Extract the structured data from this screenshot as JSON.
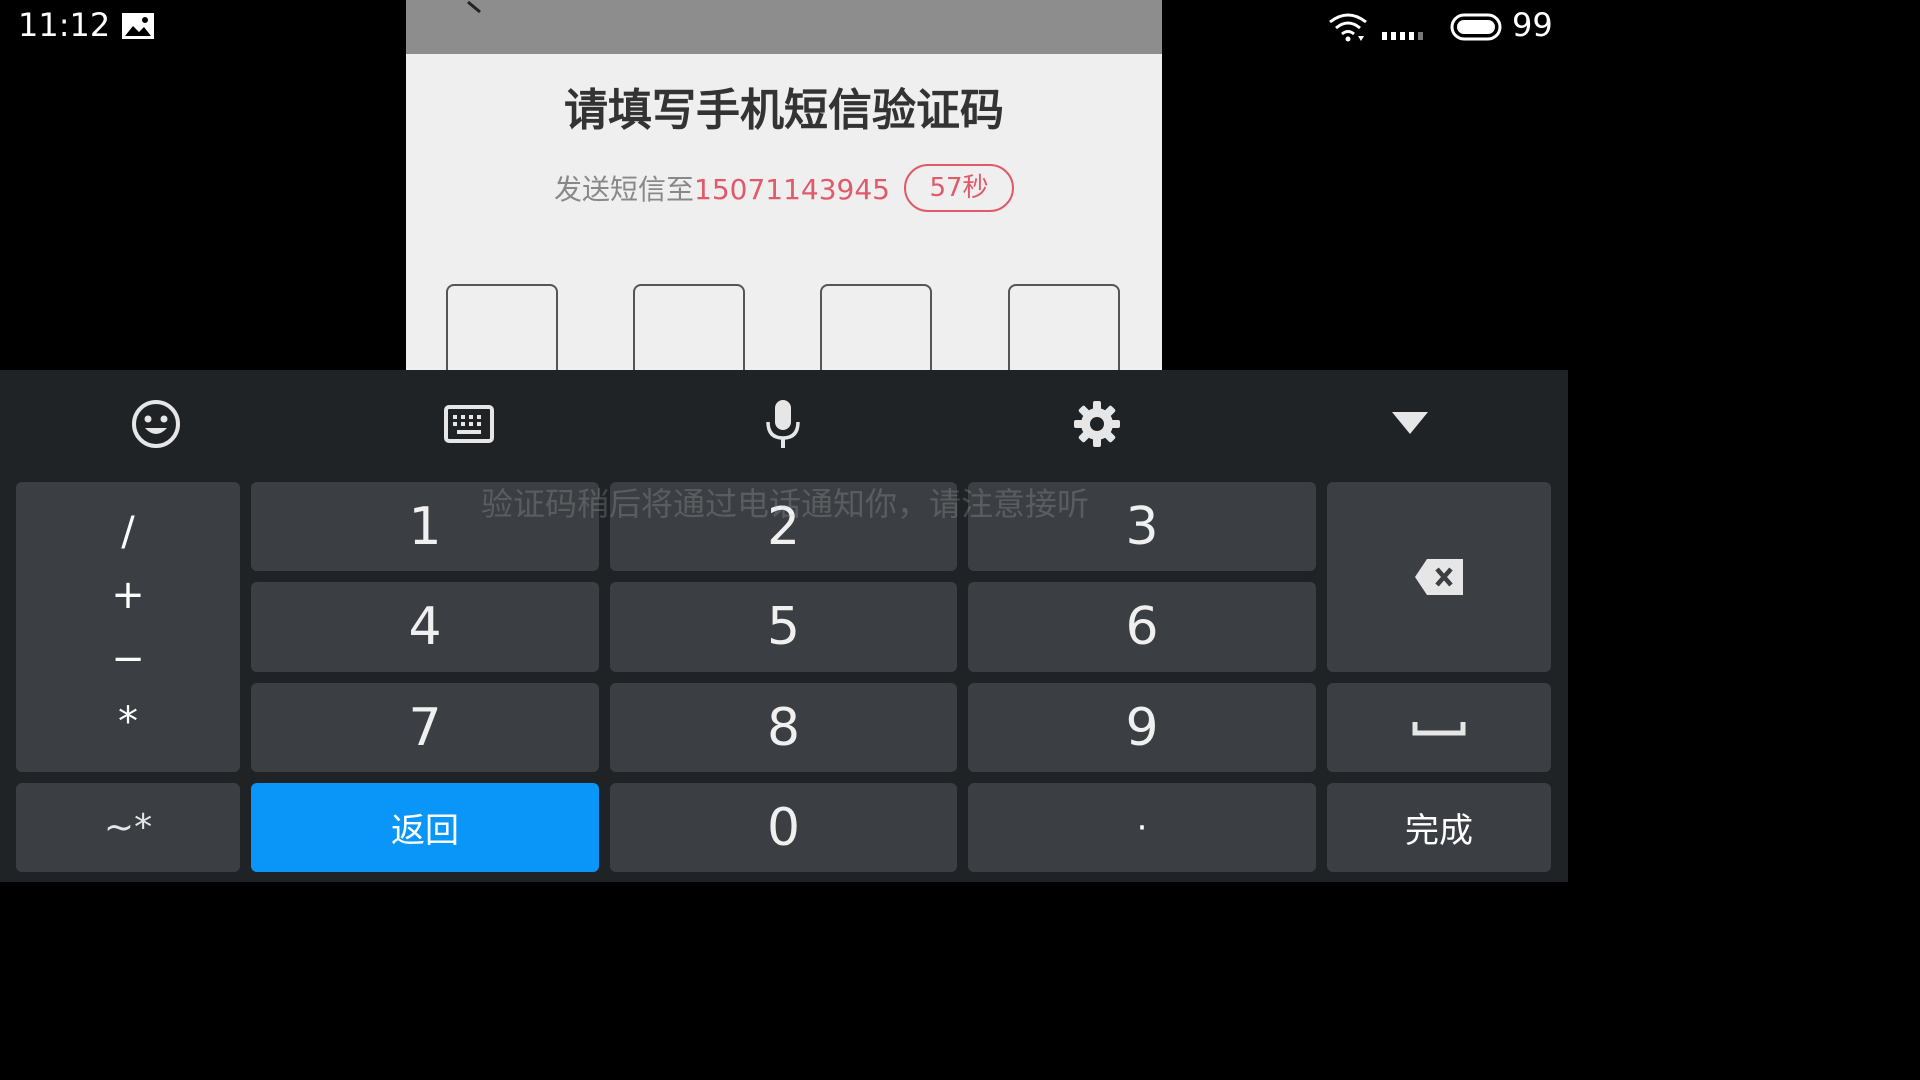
{
  "status_bar": {
    "time": "11:12",
    "battery_level": "99",
    "icons": [
      "image-notification-icon",
      "wifi-icon",
      "signal-icon",
      "battery-icon"
    ]
  },
  "dialog": {
    "title": "请填写手机短信验证码",
    "sms_prefix": "发送短信至",
    "phone_number": "15071143945",
    "countdown": "57秒",
    "code_boxes": 4,
    "colors": {
      "accent": "#e05a6a",
      "header": "#8d8d8d",
      "background": "#efefef"
    }
  },
  "hint": {
    "text": "验证码稍后将通过电话通知你，请注意接听"
  },
  "keyboard": {
    "toolbar": [
      "emoji-icon",
      "keyboard-icon",
      "microphone-icon",
      "settings-icon",
      "collapse-icon"
    ],
    "symbols": [
      "/",
      "+",
      "−",
      "*"
    ],
    "digits": {
      "k1": "1",
      "k2": "2",
      "k3": "3",
      "k4": "4",
      "k5": "5",
      "k6": "6",
      "k7": "7",
      "k8": "8",
      "k9": "9",
      "k0": "0"
    },
    "special_symbols": "~*",
    "back_label": "返回",
    "dot_label": "·",
    "done_label": "完成",
    "colors": {
      "key": "#3b3e42",
      "background": "#202326",
      "back_key": "#0a96f8"
    }
  }
}
